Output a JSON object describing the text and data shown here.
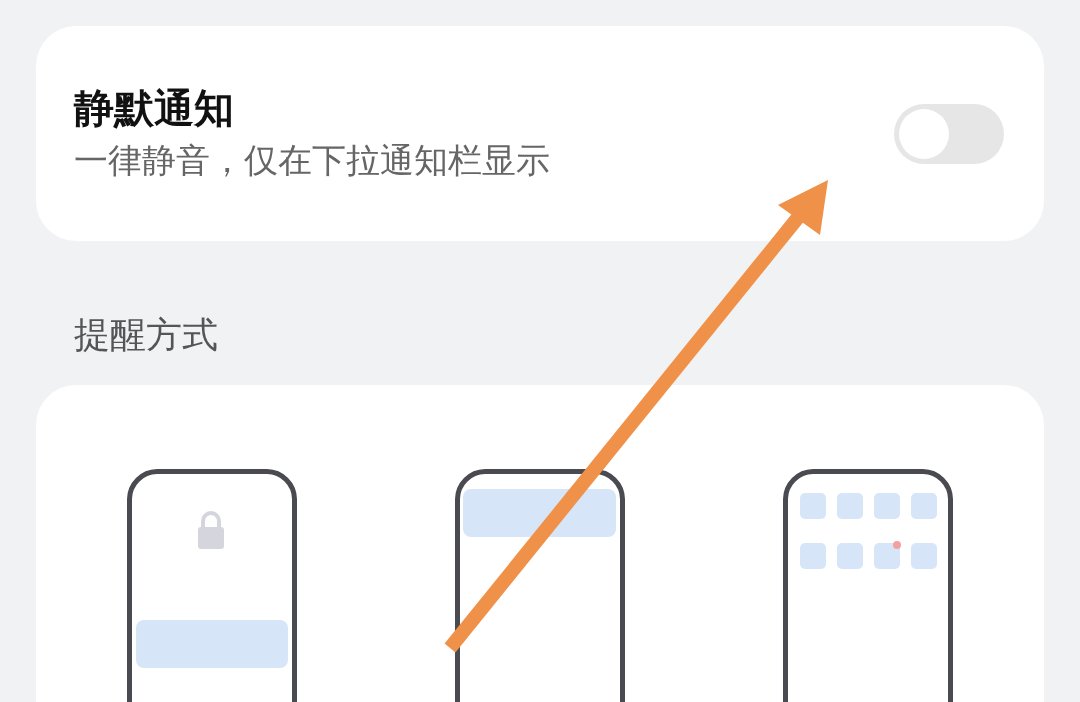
{
  "notification": {
    "title": "静默通知",
    "subtitle": "一律静音，仅在下拉通知栏显示",
    "on": false
  },
  "section_title": "提醒方式",
  "styles": [
    {
      "kind": "lock_screen"
    },
    {
      "kind": "banner"
    },
    {
      "kind": "app_icons"
    }
  ]
}
